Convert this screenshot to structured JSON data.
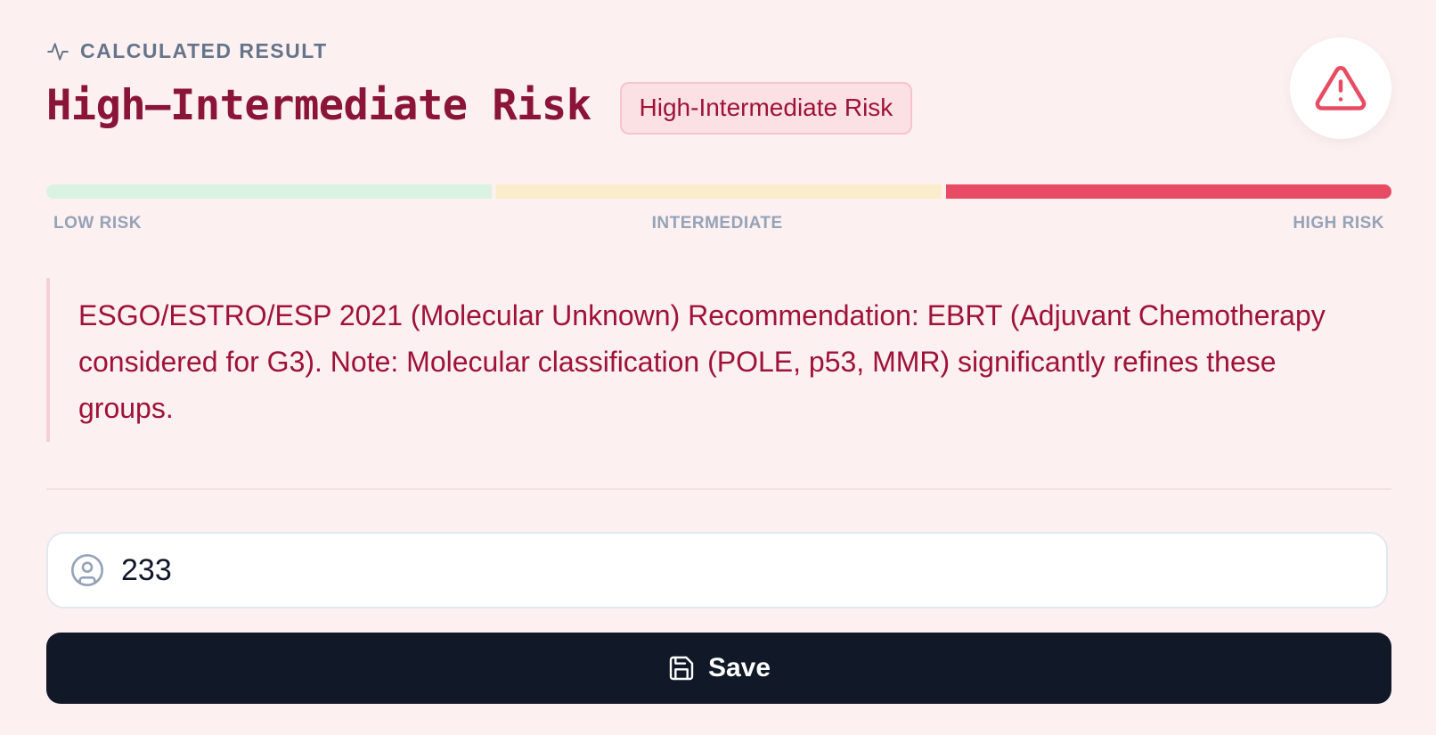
{
  "header": {
    "label": "CALCULATED RESULT",
    "title": "High–Intermediate Risk",
    "badge": "High-Intermediate Risk"
  },
  "risk_scale": {
    "labels": [
      "LOW RISK",
      "INTERMEDIATE",
      "HIGH RISK"
    ],
    "active_segment": "high",
    "colors": {
      "low": "#daf2e2",
      "intermediate": "#fbeccb",
      "high": "#e84c64"
    }
  },
  "recommendation": {
    "text": "ESGO/ESTRO/ESP 2021 (Molecular Unknown) Recommendation: EBRT (Adjuvant Chemotherapy considered for G3). Note: Molecular classification (POLE, p53, MMR) significantly refines these groups."
  },
  "patient_input": {
    "value": "233",
    "icon": "user-circle-icon"
  },
  "save_button": {
    "label": "Save",
    "icon": "save-icon"
  },
  "icons": {
    "header": "activity-icon",
    "alert": "alert-triangle-icon"
  },
  "colors": {
    "accent": "#9f1239",
    "title": "#8b1538",
    "background": "#fdf0f0",
    "button": "#111827"
  }
}
